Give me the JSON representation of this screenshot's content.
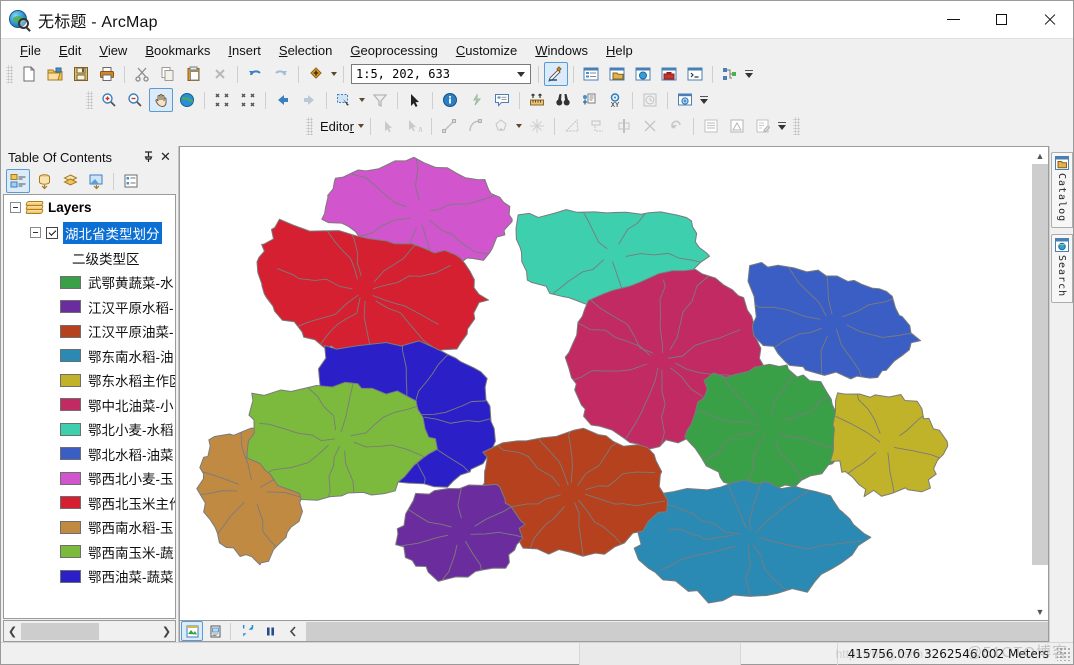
{
  "window": {
    "title": "无标题 - ArcMap",
    "app_icon": "arcmap-globe-icon",
    "minimize": "—",
    "maximize": "□",
    "close": "✕"
  },
  "menu": {
    "items": [
      {
        "label": "File",
        "accel": "F"
      },
      {
        "label": "Edit",
        "accel": "E"
      },
      {
        "label": "View",
        "accel": "V"
      },
      {
        "label": "Bookmarks",
        "accel": "B"
      },
      {
        "label": "Insert",
        "accel": "I"
      },
      {
        "label": "Selection",
        "accel": "S"
      },
      {
        "label": "Geoprocessing",
        "accel": "G"
      },
      {
        "label": "Customize",
        "accel": "C"
      },
      {
        "label": "Windows",
        "accel": "W"
      },
      {
        "label": "Help",
        "accel": "H"
      }
    ]
  },
  "standard_toolbar": {
    "buttons": [
      "new-document-icon",
      "open-folder-icon",
      "save-icon",
      "print-icon",
      "cut-scissors-icon",
      "copy-icon",
      "paste-icon",
      "delete-x-icon",
      "undo-arrow-icon",
      "redo-arrow-icon",
      "add-data-icon"
    ],
    "scale": {
      "value": "1:5, 202, 633",
      "placeholder": "1:5, 202, 633",
      "dropdown_icon": "chevron-down-icon"
    },
    "right_buttons": [
      "editor-toolbar-icon",
      "table-of-contents-icon",
      "catalog-window-icon",
      "search-window-icon",
      "arctoolbox-icon",
      "python-window-icon",
      "modelbuilder-icon"
    ],
    "overflow_icon": "toolbar-overflow-icon"
  },
  "tools_toolbar": {
    "buttons": [
      "zoom-in-icon",
      "zoom-out-icon",
      "pan-hand-icon",
      "full-extent-globe-icon",
      "fixed-zoom-in-icon",
      "fixed-zoom-out-icon",
      "go-back-extent-icon",
      "go-forward-extent-icon",
      "select-features-icon",
      "clear-selection-icon",
      "select-elements-arrow-icon",
      "identify-info-icon",
      "hyperlink-icon",
      "html-popup-icon",
      "measure-ruler-icon",
      "find-binoculars-icon",
      "find-route-icon",
      "go-to-xy-icon",
      "time-slider-icon",
      "create-viewer-window-icon"
    ],
    "active": "pan-hand-icon"
  },
  "editor_toolbar": {
    "label": "Editor",
    "accel": "r",
    "dropdown_icon": "chevron-down-icon",
    "buttons": [
      "edit-tool-icon",
      "edit-annotation-icon",
      "straight-segment-icon",
      "curve-segment-icon",
      "construction-tool-icon",
      "split-tool-icon",
      "rotate-tool-icon",
      "trace-tool-icon",
      "mirror-features-icon",
      "merge-icon",
      "intersect-icon",
      "undo-edit-icon",
      "attributes-table-icon",
      "sketch-properties-icon",
      "edit-annotation-table-icon"
    ]
  },
  "toc": {
    "title": "Table Of Contents",
    "pin_icon": "pin-icon",
    "close_icon": "close-icon",
    "tool_buttons": [
      "list-by-drawing-order-icon",
      "list-by-source-icon",
      "list-by-visibility-icon",
      "list-by-selection-icon",
      "options-icon"
    ],
    "active_tool": "list-by-drawing-order-icon",
    "root": {
      "label": "Layers",
      "icon": "layers-stack-icon",
      "expander": "collapse-icon"
    },
    "layer": {
      "name": "湖北省类型划分",
      "checked": true,
      "selected": true,
      "expander": "collapse-icon"
    },
    "field_header": "二级类型区",
    "legend": [
      {
        "label": "武鄂黄蔬菜-水",
        "color": "#3aa048"
      },
      {
        "label": "江汉平原水稻-",
        "color": "#6b2d9e"
      },
      {
        "label": "江汉平原油菜-",
        "color": "#b5411f"
      },
      {
        "label": "鄂东南水稻-油",
        "color": "#2a8ab4"
      },
      {
        "label": "鄂东水稻主作区",
        "color": "#c0b229"
      },
      {
        "label": "鄂中北油菜-小",
        "color": "#c22a63"
      },
      {
        "label": "鄂北小麦-水稻",
        "color": "#3ecfae"
      },
      {
        "label": "鄂北水稻-油菜",
        "color": "#3a5ec4"
      },
      {
        "label": "鄂西北小麦-玉",
        "color": "#d156cd"
      },
      {
        "label": "鄂西北玉米主作",
        "color": "#d42030"
      },
      {
        "label": "鄂西南水稻-玉",
        "color": "#c08a43"
      },
      {
        "label": "鄂西南玉米-蔬",
        "color": "#7cba3d"
      },
      {
        "label": "鄂西油菜-蔬菜",
        "color": "#2b20c8"
      }
    ],
    "hscroll": {
      "left_icon": "chevron-left-icon",
      "right_icon": "chevron-right-icon"
    }
  },
  "map": {
    "vscroll": {
      "up_icon": "chevron-up-icon",
      "down_icon": "chevron-down-icon"
    },
    "view_buttons": [
      "data-view-icon",
      "layout-view-icon",
      "refresh-icon",
      "pause-drawing-icon",
      "previous-extent-icon"
    ],
    "active_view": "data-view-icon",
    "outline_color": "#7b7b7b",
    "background": "#ffffff"
  },
  "right_dock": {
    "tabs": [
      {
        "label": "Catalog",
        "icon": "catalog-icon"
      },
      {
        "label": "Search",
        "icon": "search-icon"
      }
    ]
  },
  "status_bar": {
    "coordinates": "415756.076  3262546.002 Meters",
    "resize_grip": "resize-grip-icon"
  },
  "watermark": {
    "primary": "@51CTO博客",
    "secondary": "https://blog.csdn"
  }
}
